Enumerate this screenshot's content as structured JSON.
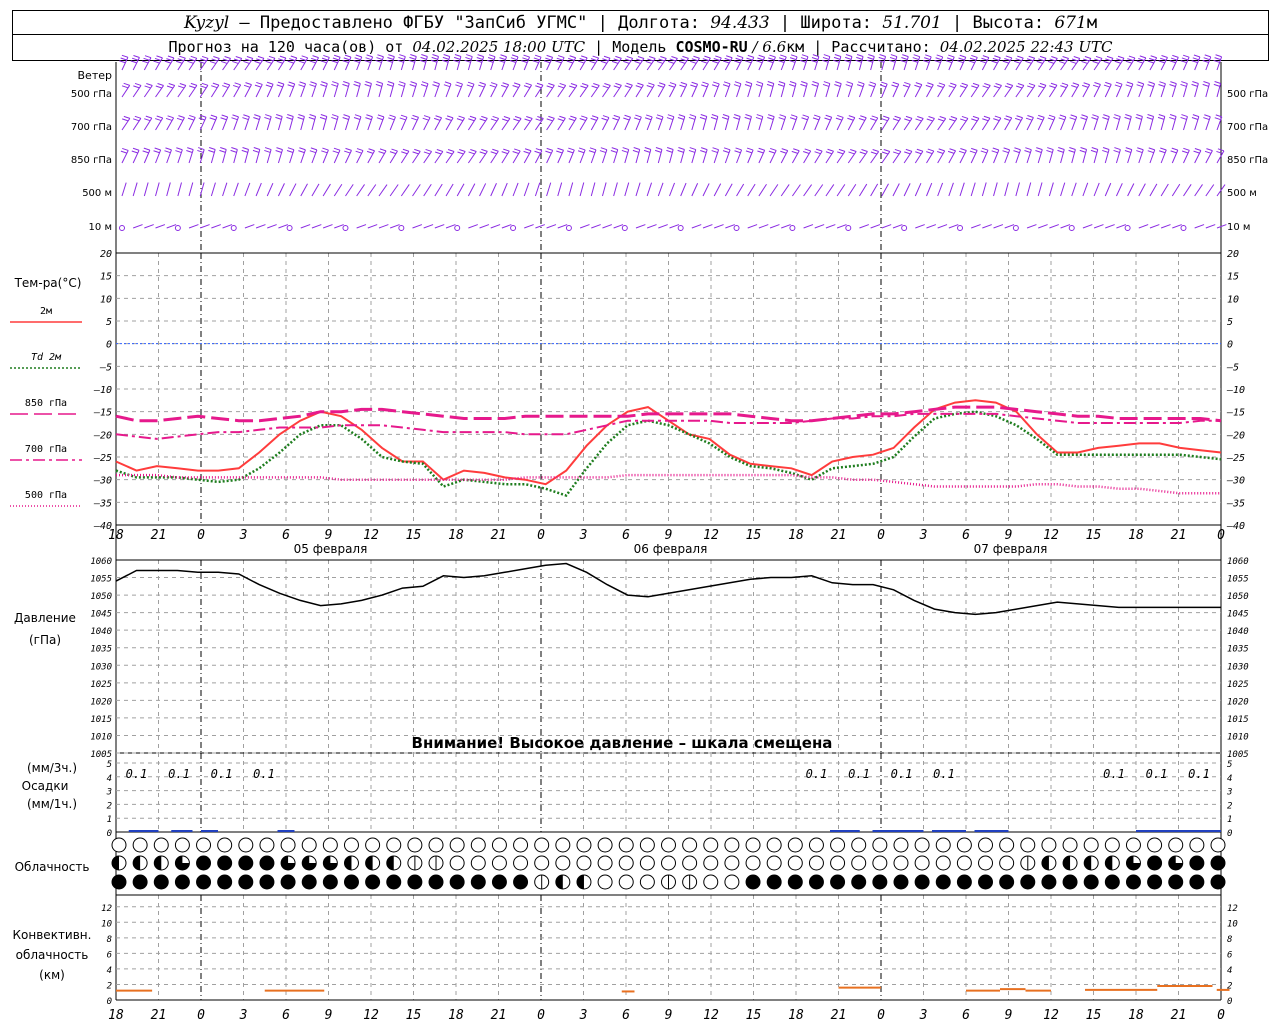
{
  "header": {
    "station": "Kyzyl",
    "provider": " – Предоставлено ФГБУ \"ЗапСиб УГМС\" | Долгота: ",
    "lon": "94.433",
    "lat_label": " | Широта: ",
    "lat": "51.701",
    "alt_label": " | Высота: ",
    "alt": "671",
    "alt_unit": "м",
    "forecast_label": "Прогноз на 120 часа(ов) от ",
    "forecast_from": "04.02.2025 18:00 UTC",
    "model_label": "  | Модель ",
    "model": "COSMO-RU",
    "model_res": " / 6.6",
    "model_res_unit": "км",
    "calc_label": " | Рассчитано: ",
    "calc_time": "04.02.2025 22:43 UTC"
  },
  "colors": {
    "t2m": "#ff3c3c",
    "td2m": "#1e7d1e",
    "t850": "#e6198c",
    "t700": "#e6198c",
    "t500": "#e6198c",
    "wind": "#8a2be2",
    "pressure": "#000000",
    "precip": "#2040c0",
    "convective": "#e87020",
    "zero_line": "#3060ff",
    "grid": "#a0a0a0"
  },
  "chart_data": {
    "type": "line",
    "x_labels": [
      "18",
      "21",
      "0",
      "3",
      "6",
      "9",
      "12",
      "15",
      "18",
      "21",
      "0",
      "3",
      "6",
      "9",
      "12",
      "15",
      "18",
      "21",
      "0",
      "3",
      "6",
      "9",
      "12",
      "15",
      "18",
      "21",
      "0"
    ],
    "day_labels": [
      "05 февраля",
      "06 февраля",
      "07 февраля"
    ],
    "wind_panel": {
      "title": "Ветер",
      "levels": [
        "500 гПа",
        "700 гПа",
        "850 гПа",
        "500 м",
        "10 м"
      ]
    },
    "temperature": {
      "title": "Тем-ра(°C)",
      "ylim": [
        -40,
        20
      ],
      "yticks": [
        20,
        15,
        10,
        5,
        0,
        -5,
        -10,
        -15,
        -20,
        -25,
        -30,
        -35,
        -40
      ],
      "series": [
        {
          "key": "t2m",
          "name": "2м",
          "style": "solid",
          "values": [
            -26,
            -28,
            -27,
            -27.5,
            -28,
            -28,
            -27.5,
            -24,
            -20,
            -17,
            -15,
            -16,
            -19,
            -23,
            -26,
            -26,
            -30,
            -28,
            -28.5,
            -29.5,
            -30,
            -31,
            -28,
            -22.5,
            -18,
            -15,
            -14,
            -17,
            -20,
            -21,
            -24.5,
            -26.5,
            -27,
            -27.5,
            -29,
            -26,
            -25,
            -24.5,
            -23,
            -18.5,
            -14.5,
            -13,
            -12.5,
            -13,
            -15,
            -20,
            -24,
            -24,
            -23,
            -22.5,
            -22,
            -22,
            -23,
            -23.5,
            -24
          ]
        },
        {
          "key": "td2m",
          "name": "Td 2м",
          "style": "dotted",
          "values": [
            -28,
            -29.5,
            -29.5,
            -29.5,
            -30,
            -30.5,
            -30,
            -27.5,
            -24,
            -20,
            -18,
            -18,
            -21,
            -25,
            -26,
            -26.5,
            -31.5,
            -30,
            -30.5,
            -31,
            -31,
            -32,
            -33.5,
            -27.5,
            -22,
            -18,
            -17,
            -18,
            -20,
            -22,
            -25,
            -27,
            -27.5,
            -28.5,
            -30,
            -27.5,
            -27,
            -26.5,
            -25,
            -20.5,
            -16.5,
            -15.5,
            -15,
            -16,
            -18,
            -21,
            -24.5,
            -24.5,
            -24.5,
            -24.5,
            -24.5,
            -24.5,
            -24.5,
            -25,
            -25.5
          ]
        },
        {
          "key": "t850",
          "name": "850 гПа",
          "style": "dash",
          "values": [
            -16,
            -17,
            -17,
            -16.5,
            -16,
            -16.5,
            -17,
            -17,
            -16.5,
            -16,
            -15,
            -15,
            -14.5,
            -14.5,
            -15,
            -15.5,
            -16,
            -16.5,
            -16.5,
            -16.5,
            -16,
            -16,
            -16,
            -16,
            -16,
            -16,
            -15.5,
            -15.5,
            -15.5,
            -15.5,
            -15.5,
            -16,
            -16.5,
            -17,
            -17,
            -16.5,
            -16,
            -15.5,
            -15.5,
            -15,
            -14.5,
            -14,
            -14,
            -14,
            -14.5,
            -15,
            -15.5,
            -16,
            -16,
            -16.5,
            -16.5,
            -16.5,
            -16.5,
            -16.5,
            -17
          ]
        },
        {
          "key": "t700",
          "name": "700 гПа",
          "style": "dashdot",
          "values": [
            -20,
            -20.5,
            -21,
            -20.5,
            -20,
            -19.5,
            -19.5,
            -19,
            -18.5,
            -18.5,
            -18.5,
            -18,
            -18,
            -18,
            -18.5,
            -19,
            -19.5,
            -19.5,
            -19.5,
            -19.5,
            -20,
            -20,
            -20,
            -19,
            -18,
            -17,
            -17,
            -17,
            -17,
            -17,
            -17.5,
            -17.5,
            -17.5,
            -17.5,
            -17,
            -16.5,
            -16.5,
            -16,
            -16,
            -15.5,
            -15.5,
            -15.5,
            -15.5,
            -15.5,
            -16,
            -16.5,
            -17,
            -17.5,
            -17.5,
            -17.5,
            -17.5,
            -17.5,
            -17.5,
            -17,
            -17
          ]
        },
        {
          "key": "t500",
          "name": "500 гПа",
          "style": "dense",
          "values": [
            -29,
            -29,
            -29,
            -29.5,
            -29.5,
            -29.5,
            -29.5,
            -29.5,
            -29.5,
            -29.5,
            -29.5,
            -30,
            -30,
            -30,
            -30,
            -30,
            -30,
            -30,
            -30,
            -30,
            -29.5,
            -29.5,
            -29.5,
            -29.5,
            -29.5,
            -29,
            -29,
            -29,
            -29,
            -29,
            -29,
            -29,
            -29,
            -29,
            -29.5,
            -29.5,
            -30,
            -30,
            -30.5,
            -31,
            -31.5,
            -31.5,
            -31.5,
            -31.5,
            -31.5,
            -31,
            -31,
            -31.5,
            -31.5,
            -32,
            -32,
            -32.5,
            -33,
            -33,
            -33
          ]
        }
      ]
    },
    "pressure": {
      "title": "Давление",
      "unit": "(гПа)",
      "ylim": [
        1005,
        1060
      ],
      "yticks": [
        1060,
        1055,
        1050,
        1045,
        1040,
        1035,
        1030,
        1025,
        1020,
        1015,
        1010,
        1005
      ],
      "warning": "Внимание! Высокое давление – шкала смещена",
      "values": [
        1054,
        1057,
        1057,
        1057,
        1056.5,
        1056.5,
        1056,
        1053,
        1050.5,
        1048.5,
        1047,
        1047.5,
        1048.5,
        1050,
        1052,
        1052.5,
        1055.5,
        1055,
        1055.5,
        1056.5,
        1057.5,
        1058.5,
        1059,
        1056.5,
        1053,
        1050,
        1049.5,
        1050.5,
        1051.5,
        1052.5,
        1053.5,
        1054.5,
        1055,
        1055,
        1055.5,
        1053.5,
        1053,
        1053,
        1051.5,
        1048.5,
        1046,
        1045,
        1044.5,
        1045,
        1046,
        1047,
        1048,
        1047.5,
        1047,
        1046.5,
        1046.5,
        1046.5,
        1046.5,
        1046.5,
        1046.5
      ]
    },
    "precip": {
      "unit_left": "(мм/3ч.)",
      "title": "Осадки",
      "unit_left2": "(мм/1ч.)",
      "ylim": [
        0,
        5
      ],
      "yticks": [
        5,
        4,
        3,
        2,
        1,
        0
      ],
      "labels": [
        {
          "x": 1,
          "text": "0.1"
        },
        {
          "x": 2,
          "text": "0.1"
        },
        {
          "x": 3,
          "text": "0.1"
        },
        {
          "x": 4,
          "text": "0.1"
        },
        {
          "x": 17,
          "text": "0.1"
        },
        {
          "x": 18,
          "text": "0.1"
        },
        {
          "x": 19,
          "text": "0.1"
        },
        {
          "x": 20,
          "text": "0.1"
        },
        {
          "x": 24,
          "text": "0.1"
        },
        {
          "x": 25,
          "text": "0.1"
        },
        {
          "x": 26,
          "text": "0.1"
        }
      ],
      "bars": [
        {
          "from": 0.3,
          "to": 1.0,
          "value": 0.1
        },
        {
          "from": 1.3,
          "to": 1.8,
          "value": 0.1
        },
        {
          "from": 2.0,
          "to": 2.4,
          "value": 0.1
        },
        {
          "from": 3.8,
          "to": 4.2,
          "value": 0.1
        },
        {
          "from": 16.8,
          "to": 17.5,
          "value": 0.1
        },
        {
          "from": 17.8,
          "to": 19.0,
          "value": 0.1
        },
        {
          "from": 19.2,
          "to": 20.0,
          "value": 0.1
        },
        {
          "from": 20.2,
          "to": 21.0,
          "value": 0.1
        },
        {
          "from": 24.0,
          "to": 24.8,
          "value": 0.1
        },
        {
          "from": 24.8,
          "to": 26.0,
          "value": 0.2
        }
      ]
    },
    "clouds": {
      "title": "Облачность",
      "rows": [
        "00000000000000000000000000000000000000000000000000000000000000000000000000000000000000000000000000000000000",
        "2223444433322211000000000000000000000000000122223434433334344333333311000000000000000000000000000000000",
        "4444444444444444444412200011004444444444444444444444444444444444444000004444444444444444"
      ]
    },
    "convective": {
      "title": "Конвективн.",
      "title2": "облачность",
      "unit": "(км)",
      "ylim": [
        0,
        13
      ],
      "yticks": [
        12,
        10,
        8,
        6,
        4,
        2,
        0
      ],
      "segments": [
        {
          "from": 0.0,
          "to": 0.85,
          "value": 1.2
        },
        {
          "from": 3.5,
          "to": 4.9,
          "value": 1.2
        },
        {
          "from": 11.9,
          "to": 12.2,
          "value": 1.1
        },
        {
          "from": 17.0,
          "to": 18.0,
          "value": 1.6
        },
        {
          "from": 20.0,
          "to": 20.8,
          "value": 1.2
        },
        {
          "from": 20.8,
          "to": 21.4,
          "value": 1.4
        },
        {
          "from": 21.4,
          "to": 22.0,
          "value": 1.2
        },
        {
          "from": 22.8,
          "to": 24.5,
          "value": 1.3
        },
        {
          "from": 24.5,
          "to": 25.8,
          "value": 1.8
        },
        {
          "from": 25.9,
          "to": 26.2,
          "value": 1.3
        }
      ]
    }
  }
}
